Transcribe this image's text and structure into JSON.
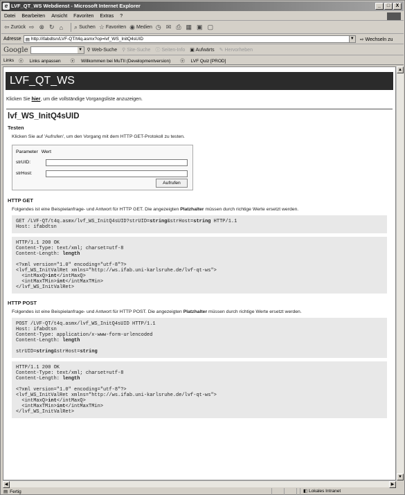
{
  "window": {
    "title": "LVF_QT_WS Webdienst - Microsoft Internet Explorer",
    "btn_min": "_",
    "btn_max": "□",
    "btn_close": "X"
  },
  "menu": [
    "Datei",
    "Bearbeiten",
    "Ansicht",
    "Favoriten",
    "Extras",
    "?"
  ],
  "toolbar": {
    "back": "Zurück",
    "search": "Suchen",
    "favorites": "Favoriten",
    "media": "Medien"
  },
  "address": {
    "label": "Adresse",
    "url": "http://ifabdtsn/LVF-QT/t4q.asmx?op=lvf_WS_InitQ4sUID",
    "go": "Wechseln zu"
  },
  "google": {
    "logo": "Google",
    "websearch": "Web-Suche",
    "sitesearch": "Site-Suche",
    "pageinfo": "Seiten-Info",
    "up": "Aufwärts",
    "highlight": "Hervorheben"
  },
  "links": {
    "label": "Links",
    "items": [
      "Links anpassen",
      "Willkommen bei MuTIl (Developmentversion)",
      "LVF Quiz [PROD]"
    ]
  },
  "page": {
    "banner": "LVF_QT_WS",
    "intro_pre": "Klicken Sie ",
    "intro_link": "hier",
    "intro_post": ", um die vollständige Vorgangsliste anzuzeigen.",
    "op_name": "lvf_WS_InitQ4sUID",
    "test_heading": "Testen",
    "test_text": "Klicken Sie auf 'Aufrufen', um den Vorgang mit dem HTTP GET-Protokoll zu testen.",
    "form": {
      "col_param": "Parameter",
      "col_value": "Wert",
      "param1": "strUID:",
      "param2": "strHost:",
      "value1": "",
      "value2": "",
      "submit": "Aufrufen"
    },
    "get": {
      "heading": "HTTP GET",
      "text_pre": "Folgendes ist eine Beispielanfrage- und Antwort für HTTP GET. Die angezeigten ",
      "text_bold": "Platzhalter",
      "text_post": " müssen durch richtige Werte ersetzt werden."
    },
    "post": {
      "heading": "HTTP POST",
      "text_pre": "Folgendes ist eine Beispielanfrage- und Antwort für HTTP POST. Die angezeigten ",
      "text_bold": "Platzhalter",
      "text_post": " müssen durch richtige Werte ersetzt werden."
    }
  },
  "status": {
    "text": "Fertig",
    "zone": "Lokales Intranet"
  }
}
